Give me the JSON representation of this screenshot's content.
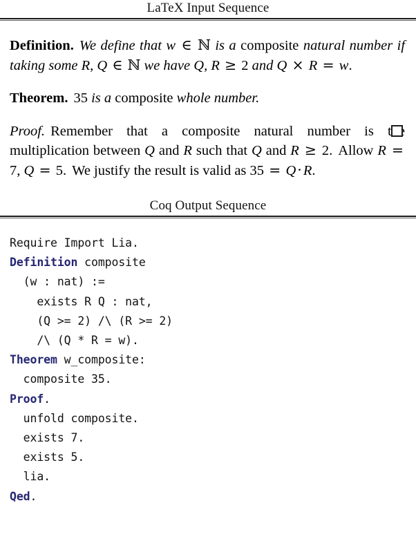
{
  "sections": {
    "latex": {
      "caption": "LaTeX Input Sequence",
      "definition": {
        "lead": "Definition.",
        "text_plain": "We define that w ∈ ℕ is a composite natural number if taking some R, Q ∈ ℕ we have Q, R ≥ 2 and Q × R = w.",
        "tokens": {
          "t1": "We define that",
          "var_w": "w",
          "in1": "∈",
          "nat_set1": "ℕ",
          "t2": "is a",
          "t3": "composite",
          "t4": "natural number if taking some",
          "var_R1": "R",
          "comma1": ",",
          "var_Q1": "Q",
          "in2": "∈",
          "nat_set2": "ℕ",
          "t5": "we have",
          "var_Q2": "Q",
          "comma2": ",",
          "var_R2": "R",
          "geq": "≥",
          "num2": "2",
          "t6": "and",
          "var_Q3": "Q",
          "times": "×",
          "var_R3": "R",
          "eq": "=",
          "var_w2": "w",
          "period": "."
        }
      },
      "theorem": {
        "lead": "Theorem.",
        "text_plain": "35 is a composite whole number.",
        "tokens": {
          "num35": "35",
          "t1": "is a",
          "t2": "composite",
          "t3": "whole number",
          "period": "."
        }
      },
      "proof": {
        "lead": "Proof.",
        "text_plain": "Remember that a composite natural number is the multiplication between Q and R such that Q and R ≥ 2. Allow R = 7, Q = 5. We justify the result is valid as 35 = Q · R.",
        "tokens": {
          "t1": "Remember that a composite natural number is the multiplication between",
          "var_Q1": "Q",
          "and1": "and",
          "var_R1": "R",
          "t2": "such that",
          "var_Q2": "Q",
          "and2": "and",
          "var_R2": "R",
          "geq": "≥",
          "num2": "2",
          "p1": ".",
          "t3": "Allow",
          "var_R3": "R",
          "eq1": "=",
          "num7": "7",
          "comma1": ",",
          "var_Q3": "Q",
          "eq2": "=",
          "num5": "5",
          "p2": ".",
          "t4": "We justify the result is valid as",
          "num35": "35",
          "eq3": "=",
          "var_Q4": "Q",
          "cdot": "·",
          "var_R4": "R",
          "p3": "."
        },
        "qed_symbol": "□"
      }
    },
    "coq": {
      "caption": "Coq Output Sequence",
      "keyword_color": "#262673",
      "text_color": "#121212",
      "code_lines": [
        {
          "id": "l1",
          "keyword": "",
          "rest": "Require Import Lia."
        },
        {
          "id": "l2",
          "keyword": "Definition",
          "rest": " composite"
        },
        {
          "id": "l3",
          "keyword": "",
          "rest": "  (w : nat) :="
        },
        {
          "id": "l4",
          "keyword": "",
          "rest": "    exists R Q : nat,"
        },
        {
          "id": "l5",
          "keyword": "",
          "rest": "    (Q >= 2) /\\ (R >= 2)"
        },
        {
          "id": "l6",
          "keyword": "",
          "rest": "    /\\ (Q * R = w)."
        },
        {
          "id": "l7",
          "keyword": "Theorem",
          "rest": " w_composite:"
        },
        {
          "id": "l8",
          "keyword": "",
          "rest": "  composite 35."
        },
        {
          "id": "l9",
          "keyword": "Proof",
          "rest": "."
        },
        {
          "id": "l10",
          "keyword": "",
          "rest": "  unfold composite."
        },
        {
          "id": "l11",
          "keyword": "",
          "rest": "  exists 7."
        },
        {
          "id": "l12",
          "keyword": "",
          "rest": "  exists 5."
        },
        {
          "id": "l13",
          "keyword": "",
          "rest": "  lia."
        },
        {
          "id": "l14",
          "keyword": "Qed",
          "rest": "."
        }
      ]
    }
  },
  "style": {
    "rule_thick_color": "#1b1b1b",
    "rule_thin_color": "#5a5a61",
    "background": "#ffffff"
  }
}
